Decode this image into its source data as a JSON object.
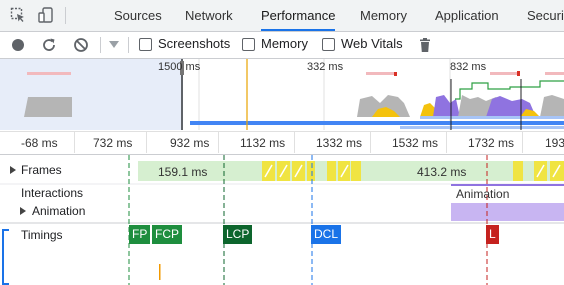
{
  "tabs": [
    {
      "label": "Sources",
      "active": false
    },
    {
      "label": "Network",
      "active": false
    },
    {
      "label": "Performance",
      "active": true
    },
    {
      "label": "Memory",
      "active": false
    },
    {
      "label": "Application",
      "active": false
    },
    {
      "label": "Securit",
      "active": false
    }
  ],
  "toolbar": {
    "screenshots_label": "Screenshots",
    "screenshots_checked": false,
    "memory_label": "Memory",
    "memory_checked": false,
    "webvitals_label": "Web Vitals",
    "webvitals_checked": false
  },
  "overview": {
    "labels": [
      "1500 ms",
      "332 ms",
      "832 ms"
    ]
  },
  "ruler": {
    "ticks": [
      "-68 ms",
      "732 ms",
      "932 ms",
      "1132 ms",
      "1332 ms",
      "1532 ms",
      "1732 ms",
      "193"
    ]
  },
  "tracks": {
    "frames_label": "Frames",
    "frame_time_1": "159.1 ms",
    "frame_time_2": "413.2 ms",
    "interactions_label": "Interactions",
    "animation_label": "Animation",
    "animation_bar_label": "Animation",
    "timings_label": "Timings"
  },
  "timings": [
    {
      "label": "FP",
      "color": "#1e8e3e"
    },
    {
      "label": "FCP",
      "color": "#1e8e3e"
    },
    {
      "label": "LCP",
      "color": "#0d652d"
    },
    {
      "label": "DCL",
      "color": "#1a73e8"
    },
    {
      "label": "L",
      "color": "#c5221f"
    }
  ]
}
